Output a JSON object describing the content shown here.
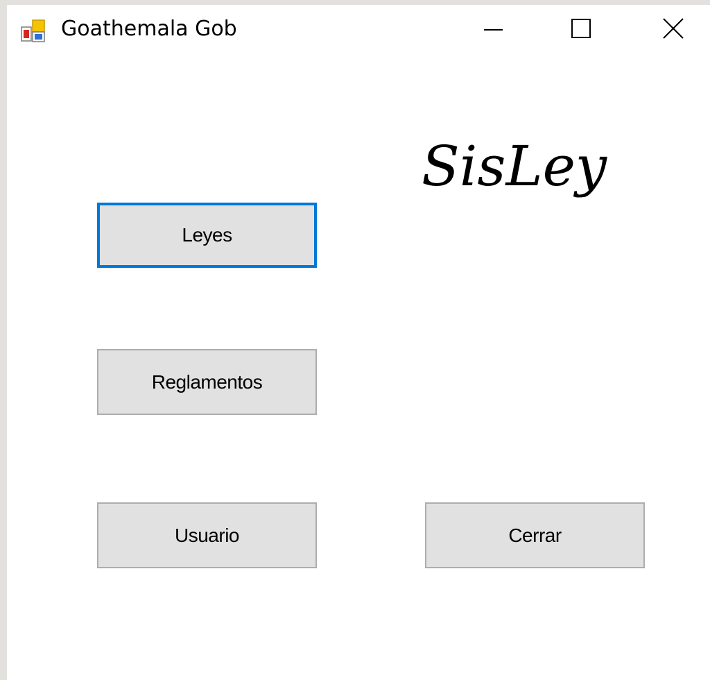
{
  "window": {
    "title": "Goathemala Gob",
    "icon": "app-form-icon",
    "controls": {
      "minimize_icon": "minimize-icon",
      "maximize_icon": "maximize-icon",
      "close_icon": "close-icon"
    }
  },
  "main": {
    "logo_text": "SisLey",
    "buttons": {
      "leyes": "Leyes",
      "reglamentos": "Reglamentos",
      "usuario": "Usuario",
      "cerrar": "Cerrar"
    },
    "focused_button": "leyes"
  },
  "colors": {
    "window_bg": "#ffffff",
    "button_bg": "#e1e1e1",
    "button_border": "#adadad",
    "focus_border": "#0078d7",
    "desktop_bg": "#e3e1de"
  }
}
